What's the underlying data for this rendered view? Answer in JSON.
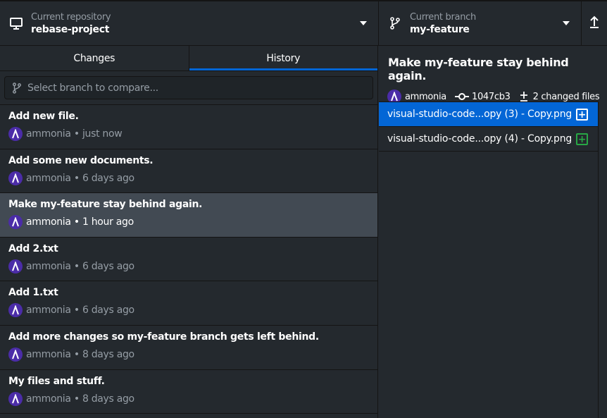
{
  "toolbar": {
    "repository": {
      "label": "Current repository",
      "value": "rebase-project"
    },
    "branch": {
      "label": "Current branch",
      "value": "my-feature"
    }
  },
  "tabs": [
    {
      "label": "Changes",
      "active": false
    },
    {
      "label": "History",
      "active": true
    }
  ],
  "filter": {
    "placeholder": "Select branch to compare..."
  },
  "commits": [
    {
      "summary": "Add new file.",
      "author": "ammonia",
      "time": "just now"
    },
    {
      "summary": "Add some new documents.",
      "author": "ammonia",
      "time": "6 days ago"
    },
    {
      "summary": "Make my-feature stay behind again.",
      "author": "ammonia",
      "time": "1 hour ago",
      "selected": true
    },
    {
      "summary": "Add 2.txt",
      "author": "ammonia",
      "time": "6 days ago"
    },
    {
      "summary": "Add 1.txt",
      "author": "ammonia",
      "time": "6 days ago"
    },
    {
      "summary": "Add more changes so my-feature branch gets left behind.",
      "author": "ammonia",
      "time": "8 days ago"
    },
    {
      "summary": "My files and stuff.",
      "author": "ammonia",
      "time": "8 days ago"
    }
  ],
  "commit_detail": {
    "title": "Make my-feature stay behind again.",
    "author": "ammonia",
    "sha": "1047cb3",
    "changed": "2 changed files",
    "files": [
      {
        "name": "visual-studio-code...opy (3) - Copy.png",
        "status": "added",
        "selected": true
      },
      {
        "name": "visual-studio-code...opy (4) - Copy.png",
        "status": "added"
      }
    ]
  },
  "colors": {
    "accent": "#0366d6",
    "added": "#28a745",
    "avatar": "#4b2ca8"
  }
}
